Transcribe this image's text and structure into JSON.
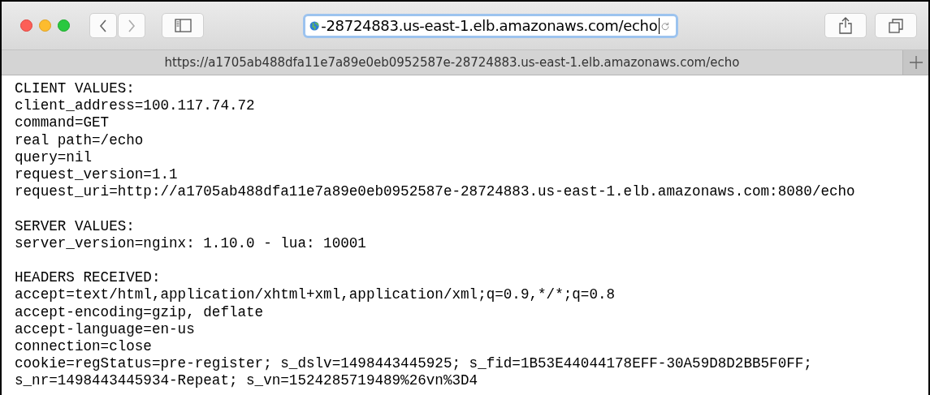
{
  "address_bar": {
    "value": "-28724883.us-east-1.elb.amazonaws.com/echo",
    "focused": true
  },
  "tab": {
    "title": "https://a1705ab488dfa11e7a89e0eb0952587e-28724883.us-east-1.elb.amazonaws.com/echo"
  },
  "page": {
    "sections": [
      {
        "heading": "CLIENT VALUES:",
        "lines": [
          "client_address=100.117.74.72",
          "command=GET",
          "real path=/echo",
          "query=nil",
          "request_version=1.1",
          "request_uri=http://a1705ab488dfa11e7a89e0eb0952587e-28724883.us-east-1.elb.amazonaws.com:8080/echo"
        ]
      },
      {
        "heading": "SERVER VALUES:",
        "lines": [
          "server_version=nginx: 1.10.0 - lua: 10001"
        ]
      },
      {
        "heading": "HEADERS RECEIVED:",
        "lines": [
          "accept=text/html,application/xhtml+xml,application/xml;q=0.9,*/*;q=0.8",
          "accept-encoding=gzip, deflate",
          "accept-language=en-us",
          "connection=close",
          "cookie=regStatus=pre-register; s_dslv=1498443445925; s_fid=1B53E44044178EFF-30A59D8D2BB5F0FF;",
          "s_nr=1498443445934-Repeat; s_vn=1524285719489%26vn%3D4"
        ]
      }
    ]
  }
}
